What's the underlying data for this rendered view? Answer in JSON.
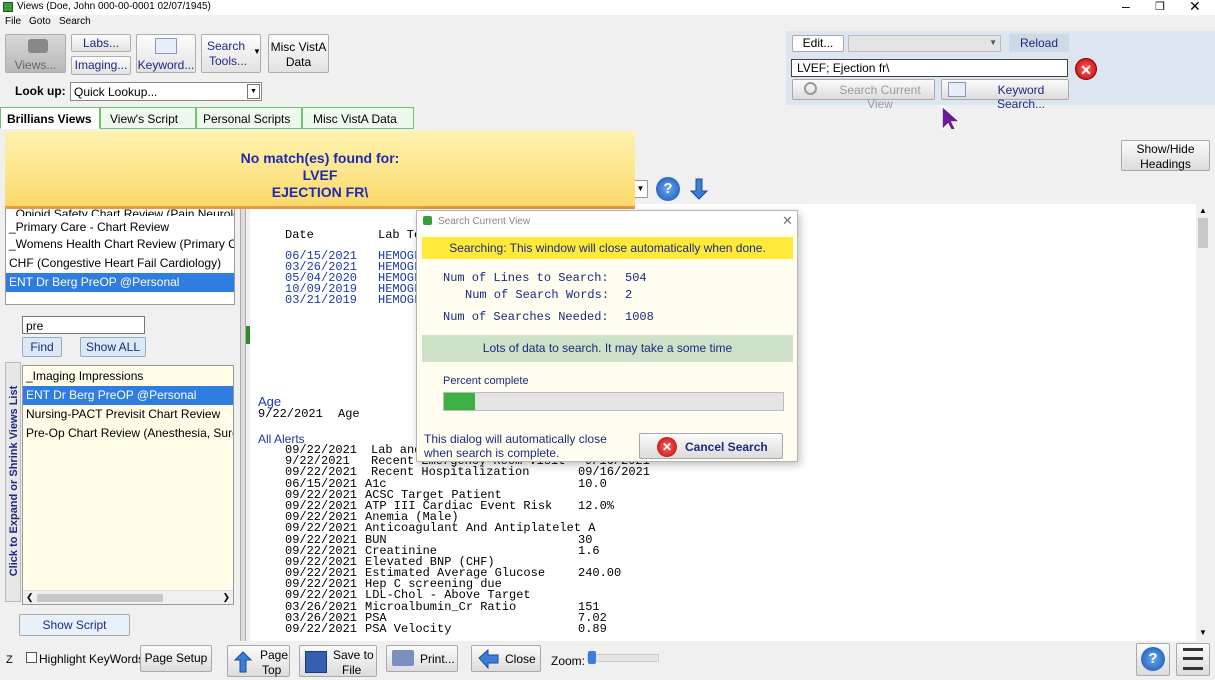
{
  "window": {
    "title": "Views (Doe, John  000-00-0001 02/07/1945)",
    "menu": [
      "File",
      "Goto",
      "Search"
    ]
  },
  "toolbar": {
    "views_label": "Views...",
    "labs_label": "Labs...",
    "imaging_label": "Imaging...",
    "keyword_label": "Keyword...",
    "search_tools_line1": "Search",
    "search_tools_line2": "Tools...",
    "misc_vista_line1": "Misc VistA",
    "misc_vista_line2": "Data",
    "lookup_label": "Look up:",
    "lookup_value": "Quick Lookup..."
  },
  "search_panel": {
    "edit_label": "Edit...",
    "reload_label": "Reload",
    "search_text": "LVEF; Ejection fr\\",
    "search_current_view_label": "Search Current View",
    "keyword_search_label": "Keyword Search..."
  },
  "tabs": [
    "Brillians Views",
    "View's Script",
    "Personal Scripts",
    "Misc VistA Data"
  ],
  "notice": {
    "line1": "No match(es) found for:",
    "line2": "LVEF",
    "line3": "EJECTION FR\\"
  },
  "show_hide": {
    "line1": "Show/Hide",
    "line2": "Headings"
  },
  "views_list": [
    "_Opioid Safety Chart Review (Pain Neurology I",
    "_Primary Care - Chart Review",
    "_Womens Health Chart Review (Primary Care",
    "CHF (Congestive Heart Fail Cardiology)",
    "ENT Dr Berg PreOP @Personal"
  ],
  "filter": {
    "value": "pre",
    "find_label": "Find",
    "show_all_label": "Show ALL"
  },
  "filtered_list": [
    "_Imaging Impressions",
    "ENT Dr Berg PreOP @Personal",
    "Nursing-PACT Previsit Chart Review",
    "Pre-Op Chart Review (Anesthesia, Surgery"
  ],
  "side_label": "Click to Expand or Shrink Views List",
  "show_script_label": "Show Script",
  "report": {
    "lab_header": [
      "Date",
      "Lab Te"
    ],
    "lab_rows": [
      [
        "06/15/2021",
        "HEMOGL"
      ],
      [
        "03/26/2021",
        "HEMOGL"
      ],
      [
        "05/04/2020",
        "HEMOGL"
      ],
      [
        "10/09/2019",
        "HEMOGL"
      ],
      [
        "03/21/2019",
        "HEMOGL"
      ]
    ],
    "age_heading": "Age",
    "age_date": "9/22/2021",
    "age_label": "Age",
    "alerts_heading": "All Alerts",
    "alerts": [
      [
        "09/22/2021",
        "Lab and",
        ""
      ],
      [
        "9/22/2021",
        "Recent Emergency Room Visit",
        "9/16/2021"
      ],
      [
        "09/22/2021",
        "Recent Hospitalization",
        "09/16/2021"
      ],
      [
        "06/15/2021",
        "A1c",
        "10.0"
      ],
      [
        "09/22/2021",
        "ACSC Target Patient",
        ""
      ],
      [
        "09/22/2021",
        "ATP III Cardiac Event Risk",
        "12.0%"
      ],
      [
        "09/22/2021",
        "Anemia (Male)",
        ""
      ],
      [
        "09/22/2021",
        "Anticoagulant And Antiplatelet A",
        ""
      ],
      [
        "09/22/2021",
        "BUN",
        "30"
      ],
      [
        "09/22/2021",
        "Creatinine",
        "1.6"
      ],
      [
        "09/22/2021",
        "Elevated BNP (CHF)",
        ""
      ],
      [
        "09/22/2021",
        "Estimated Average Glucose",
        "240.00"
      ],
      [
        "09/22/2021",
        "Hep C screening due",
        ""
      ],
      [
        "09/22/2021",
        "LDL-Chol - Above Target",
        ""
      ],
      [
        "03/26/2021",
        "Microalbumin_Cr Ratio",
        "151"
      ],
      [
        "03/26/2021",
        "PSA",
        "7.02"
      ],
      [
        "09/22/2021",
        "PSA Velocity",
        "0.89"
      ]
    ]
  },
  "dialog": {
    "title": "Search Current View",
    "status": "Searching: This window will close automatically when done.",
    "lines_label": "Num of Lines to Search:",
    "lines_value": "504",
    "words_label": "Num of Search Words:",
    "words_value": "2",
    "searches_label": "Num of Searches Needed:",
    "searches_value": "1008",
    "info": "Lots of data to search. It may take a some time",
    "percent_label": "Percent complete",
    "progress_fraction": 0.09,
    "auto_close_line1": "This dialog will automatically close",
    "auto_close_line2": "when search is complete.",
    "cancel_label": "Cancel Search"
  },
  "bottom": {
    "z_label": "Z",
    "highlight_label": "Highlight KeyWords",
    "page_setup_label": "Page Setup",
    "page_top_line1": "Page",
    "page_top_line2": "Top",
    "save_line1": "Save to",
    "save_line2": "File",
    "print_label": "Print...",
    "close_label": "Close",
    "zoom_label": "Zoom:"
  },
  "colors": {
    "accent": "#2f7de1",
    "tab_border": "#6fc36f",
    "notice_bg": "#fde98a",
    "notice_text": "#1c2bb0",
    "progress": "#3cb043"
  }
}
